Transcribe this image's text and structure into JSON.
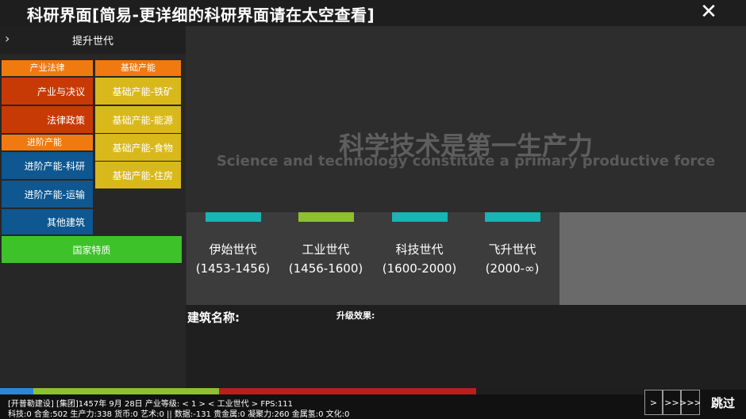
{
  "window": {
    "title": "科研界面[简易-更详细的科研界面请在太空查看]"
  },
  "sidebar": {
    "header_label": "提升世代",
    "categories": {
      "industry_law": "产业法律",
      "basic_production": "基础产能",
      "advanced_production": "进阶产能"
    },
    "buttons": {
      "industry_resolution": "产业与决议",
      "law_policy": "法律政策",
      "advanced_research": "进阶产能-科研",
      "advanced_transport": "进阶产能-运输",
      "other_buildings": "其他建筑",
      "national_traits": "国家特质",
      "basic_iron": "基础产能-铁矿",
      "basic_energy": "基础产能-能源",
      "basic_food": "基础产能-食物",
      "basic_housing": "基础产能-住房"
    }
  },
  "main": {
    "slogan_cn": "科学技术是第一生产力",
    "slogan_en": "Science and technology constitute a primary productive force",
    "eras": [
      {
        "name": "伊始世代",
        "range": "(1453-1456)",
        "color": "#1bb3b3"
      },
      {
        "name": "工业世代",
        "range": "(1456-1600)",
        "color": "#8dc032"
      },
      {
        "name": "科技世代",
        "range": "(1600-2000)",
        "color": "#1bb3b3"
      },
      {
        "name": "飞升世代",
        "range": "(2000-∞)",
        "color": "#1bb3b3"
      }
    ],
    "building_name_label": "建筑名称:",
    "upgrade_effect_label": "升级效果:"
  },
  "status": {
    "line1": "[开普勒建设] [集团]1457年 9月 28日 产业等级: < 1 > < 工业世代 > FPS:111",
    "line2": "科技:0 合金:502 生产力:338 货币:0 艺术:0 || 数据:-131 贵金属:0 凝聚力:260 金属氢:0 文化:0"
  },
  "controls": {
    "speed1": ">",
    "speed2": ">>",
    "speed3": ">>>",
    "skip": "跳过"
  },
  "colors": {
    "orange": "#f07a10",
    "red": "#c83a05",
    "yellow": "#d9b81c",
    "blue": "#0e5790",
    "green": "#3ec22a",
    "progress_blue": "#2e86d6",
    "progress_green": "#8dc032",
    "progress_red": "#b81f1f"
  }
}
